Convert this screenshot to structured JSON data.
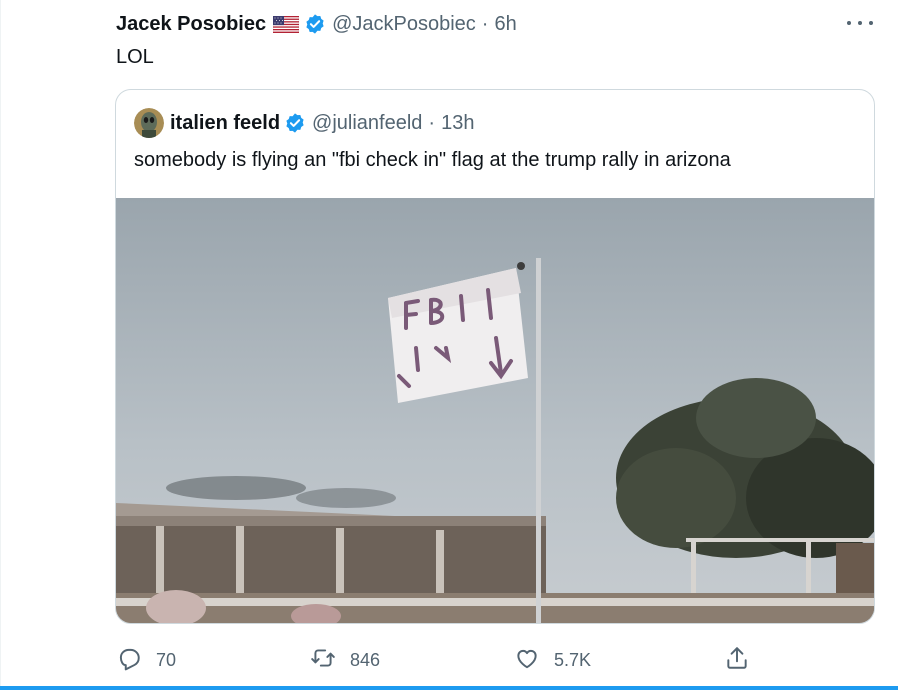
{
  "tweet": {
    "author_name": "Jacek Posobiec",
    "author_handle": "@JackPosobiec",
    "time": "6h",
    "separator": "·",
    "text": "LOL"
  },
  "quoted_tweet": {
    "author_name": "italien feeld",
    "author_handle": "@julianfeeld",
    "time": "13h",
    "separator": "·",
    "text": "somebody is flying an \"fbi check in\" flag at the trump rally in arizona"
  },
  "actions": {
    "reply_count": "70",
    "retweet_count": "846",
    "like_count": "5.7K"
  },
  "colors": {
    "verified": "#1d9bf0",
    "secondary_text": "#536471",
    "accent_bar": "#1d9bf0"
  },
  "icons": [
    "more-icon",
    "verified-badge-icon",
    "us-flag-emoji",
    "reply-icon",
    "retweet-icon",
    "like-icon",
    "share-icon"
  ]
}
